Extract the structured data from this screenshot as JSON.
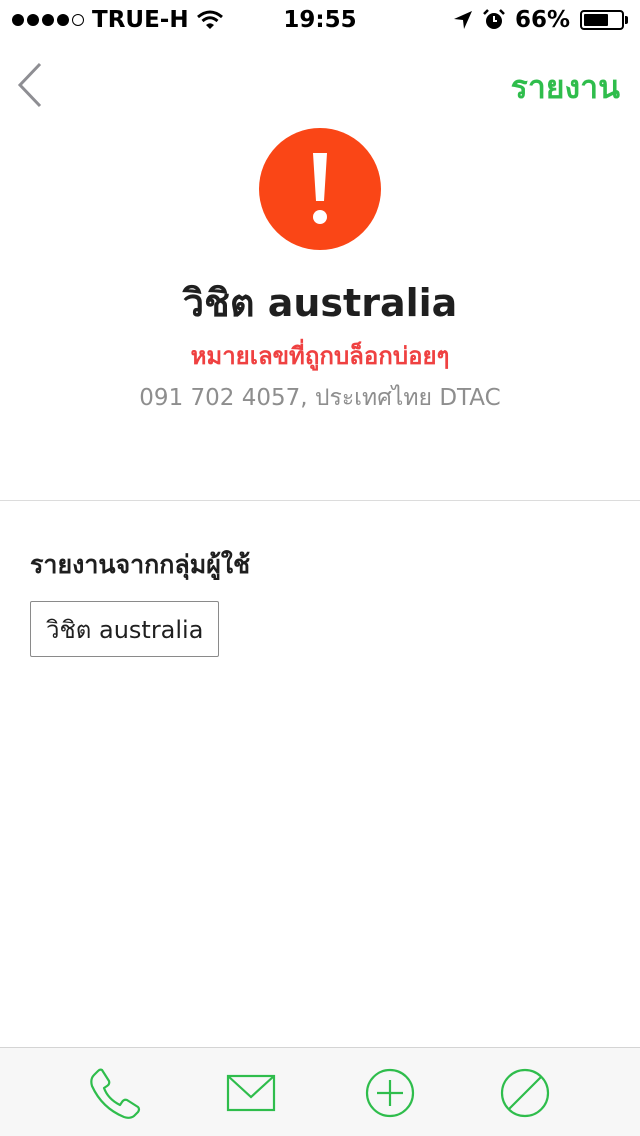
{
  "status_bar": {
    "carrier": "TRUE-H",
    "time": "19:55",
    "battery_percent": "66%",
    "battery_level": 0.66,
    "signal_bars": 4
  },
  "nav": {
    "back_icon": "chevron-left-icon",
    "report_label": "รายงาน"
  },
  "header": {
    "icon": "exclamation-icon",
    "icon_color": "#fa4616",
    "contact_name": "วิชิต australia",
    "warning": "หมายเลขที่ถูกบล็อกบ่อยๆ",
    "phone_info": "091 702 4057, ประเทศไทย DTAC"
  },
  "reports": {
    "title": "รายงานจากกลุ่มผู้ใช้",
    "tags": [
      "วิชิต australia"
    ]
  },
  "toolbar": {
    "items": [
      "phone-icon",
      "envelope-icon",
      "add-circle-icon",
      "block-icon"
    ],
    "accent_color": "#2fbd4c"
  }
}
